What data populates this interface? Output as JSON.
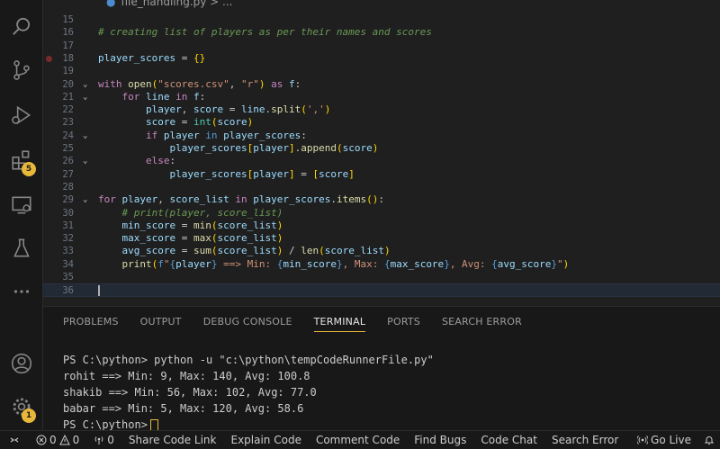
{
  "editor": {
    "tab_title": "file_handling.py > ...",
    "lines": [
      {
        "n": "15",
        "fold": "",
        "html": ""
      },
      {
        "n": "16",
        "fold": "",
        "html": "<span class='c'># creating list of players as per their names and scores</span>"
      },
      {
        "n": "17",
        "fold": "",
        "html": ""
      },
      {
        "n": "18",
        "fold": "",
        "html": "<span class='v'>player_scores</span> = <span class='p1'>{}</span>",
        "breakpoint": true
      },
      {
        "n": "19",
        "fold": "",
        "html": ""
      },
      {
        "n": "20",
        "fold": "v",
        "html": "<span class='k'>with</span> <span class='f'>open</span><span class='p1'>(</span><span class='s'>\"scores.csv\"</span>, <span class='s'>\"r\"</span><span class='p1'>)</span> <span class='k'>as</span> <span class='v'>f</span>:"
      },
      {
        "n": "21",
        "fold": "v",
        "html": "    <span class='k'>for</span> <span class='v'>line</span> <span class='k'>in</span> <span class='v'>f</span>:"
      },
      {
        "n": "22",
        "fold": "",
        "html": "        <span class='v'>player</span>, <span class='v'>score</span> = <span class='v'>line</span>.<span class='f'>split</span><span class='p1'>(</span><span class='s'>','</span><span class='p1'>)</span>"
      },
      {
        "n": "23",
        "fold": "",
        "html": "        <span class='v'>score</span> = <span class='t'>int</span><span class='p1'>(</span><span class='v'>score</span><span class='p1'>)</span>"
      },
      {
        "n": "24",
        "fold": "v",
        "html": "        <span class='k'>if</span> <span class='v'>player</span> <span class='b'>in</span> <span class='v'>player_scores</span>:"
      },
      {
        "n": "25",
        "fold": "",
        "html": "            <span class='v'>player_scores</span><span class='p1'>[</span><span class='v'>player</span><span class='p1'>]</span>.<span class='f'>append</span><span class='p1'>(</span><span class='v'>score</span><span class='p1'>)</span>"
      },
      {
        "n": "26",
        "fold": "v",
        "html": "        <span class='k'>else</span>:"
      },
      {
        "n": "27",
        "fold": "",
        "html": "            <span class='v'>player_scores</span><span class='p1'>[</span><span class='v'>player</span><span class='p1'>]</span> = <span class='p1'>[</span><span class='v'>score</span><span class='p1'>]</span>"
      },
      {
        "n": "28",
        "fold": "",
        "html": ""
      },
      {
        "n": "29",
        "fold": "v",
        "html": "<span class='k'>for</span> <span class='v'>player</span>, <span class='v'>score_list</span> <span class='k'>in</span> <span class='v'>player_scores</span>.<span class='f'>items</span><span class='p1'>()</span>:"
      },
      {
        "n": "30",
        "fold": "",
        "html": "    <span class='c'># print(player, score_list)</span>"
      },
      {
        "n": "31",
        "fold": "",
        "html": "    <span class='v'>min_score</span> = <span class='f'>min</span><span class='p1'>(</span><span class='v'>score_list</span><span class='p1'>)</span>"
      },
      {
        "n": "32",
        "fold": "",
        "html": "    <span class='v'>max_score</span> = <span class='f'>max</span><span class='p1'>(</span><span class='v'>score_list</span><span class='p1'>)</span>"
      },
      {
        "n": "33",
        "fold": "",
        "html": "    <span class='v'>avg_score</span> = <span class='f'>sum</span><span class='p1'>(</span><span class='v'>score_list</span><span class='p1'>)</span> / <span class='f'>len</span><span class='p1'>(</span><span class='v'>score_list</span><span class='p1'>)</span>"
      },
      {
        "n": "34",
        "fold": "",
        "html": "    <span class='f'>print</span><span class='p1'>(</span><span class='b'>f</span><span class='s'>\"</span><span class='b'>{</span><span class='v'>player</span><span class='b'>}</span><span class='s'> ==> Min: </span><span class='b'>{</span><span class='v'>min_score</span><span class='b'>}</span><span class='s'>, Max: </span><span class='b'>{</span><span class='v'>max_score</span><span class='b'>}</span><span class='s'>, Avg: </span><span class='b'>{</span><span class='v'>avg_score</span><span class='b'>}</span><span class='s'>\"</span><span class='p1'>)</span>"
      },
      {
        "n": "35",
        "fold": "",
        "html": ""
      },
      {
        "n": "36",
        "fold": "",
        "html": "<span class='cursor'></span>",
        "active": true
      }
    ]
  },
  "activity": {
    "extensions_badge": "5",
    "settings_badge": "1"
  },
  "panel": {
    "tabs": [
      {
        "label": "PROBLEMS",
        "active": false
      },
      {
        "label": "OUTPUT",
        "active": false
      },
      {
        "label": "DEBUG CONSOLE",
        "active": false
      },
      {
        "label": "TERMINAL",
        "active": true
      },
      {
        "label": "PORTS",
        "active": false
      },
      {
        "label": "SEARCH ERROR",
        "active": false
      }
    ],
    "terminal_lines": [
      "PS C:\\python> python -u \"c:\\python\\tempCodeRunnerFile.py\"",
      "rohit ==> Min: 9, Max: 140, Avg: 100.8",
      "shakib ==> Min: 56, Max: 102, Avg: 77.0",
      "babar ==> Min: 5, Max: 120, Avg: 58.6"
    ],
    "prompt": "PS C:\\python>"
  },
  "status": {
    "errors": "0",
    "warnings": "0",
    "ports": "0",
    "items": [
      "Share Code Link",
      "Explain Code",
      "Comment Code",
      "Find Bugs",
      "Code Chat",
      "Search Error"
    ],
    "go_live": "Go Live"
  },
  "colors": {
    "accent": "#e8b83a",
    "background": "#1f1f1f"
  }
}
